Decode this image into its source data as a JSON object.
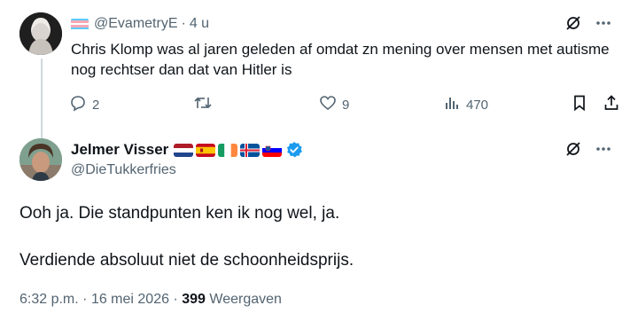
{
  "reply": {
    "handle": "@EvametryE",
    "separator": "·",
    "time": "4 u",
    "text": "Chris Klomp was al jaren geleden af omdat zn mening over mensen met autisme nog rechtser dan dat van Hitler is",
    "actions": {
      "replies": "2",
      "retweets": "",
      "likes": "9",
      "views": "470"
    },
    "flag_icon": "transgender-pride-flag"
  },
  "main_post": {
    "display_name": "Jelmer Visser",
    "flags": [
      "netherlands-flag",
      "spain-flag",
      "ireland-flag",
      "iceland-flag",
      "slovenia-flag"
    ],
    "verified": true,
    "handle": "@DieTukkerfries",
    "line1": "Ooh ja. Die standpunten ken ik nog wel, ja.",
    "line2": "Verdiende absoluut niet de schoonheidsprijs.",
    "time": "6:32 p.m.",
    "separator": "·",
    "date": "16 mei 2026",
    "views_count": "399",
    "views_label": "Weergaven"
  },
  "colors": {
    "text": "#0f1419",
    "secondary": "#536471",
    "verified": "#1d9bf0",
    "thread_line": "#cfd9de"
  }
}
